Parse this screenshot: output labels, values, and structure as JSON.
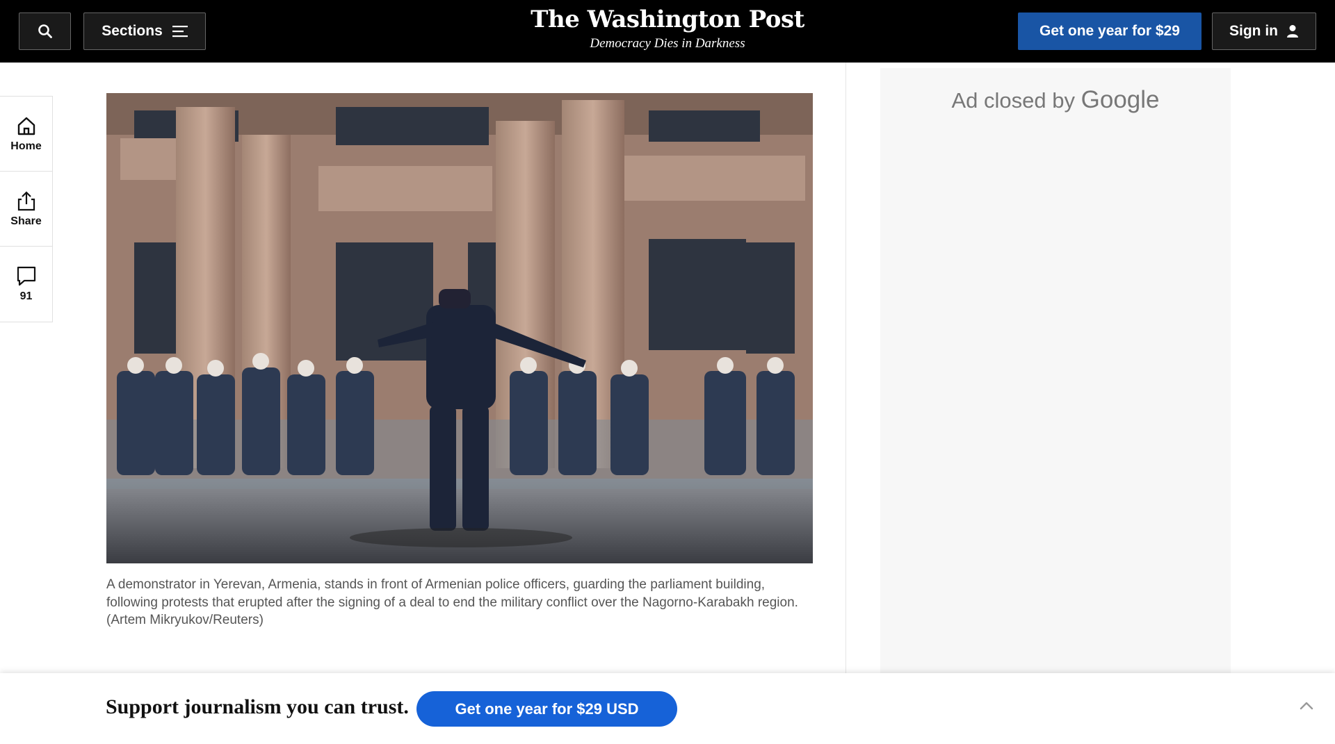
{
  "header": {
    "sections_label": "Sections",
    "logo_text": "The Washington Post",
    "tagline": "Democracy Dies in Darkness",
    "subscribe_label": "Get one year for $29",
    "signin_label": "Sign in"
  },
  "rail": {
    "home_label": "Home",
    "share_label": "Share",
    "comments_count": "91"
  },
  "article": {
    "caption": "A demonstrator in Yerevan, Armenia, stands in front of Armenian police officers, guarding the parliament building, following protests that erupted after the signing of a deal to end the military conflict over the Nagorno-Karabakh region. (Artem Mikryukov/Reuters)"
  },
  "ad": {
    "closed_text": "Ad closed by",
    "google_text": "Google"
  },
  "banner": {
    "message": "Support journalism you can trust.",
    "cta_label": "Get one year for $29 USD"
  },
  "colors": {
    "header_bg": "#000000",
    "subscribe_blue": "#1955a5",
    "banner_cta_blue": "#1662d8"
  }
}
